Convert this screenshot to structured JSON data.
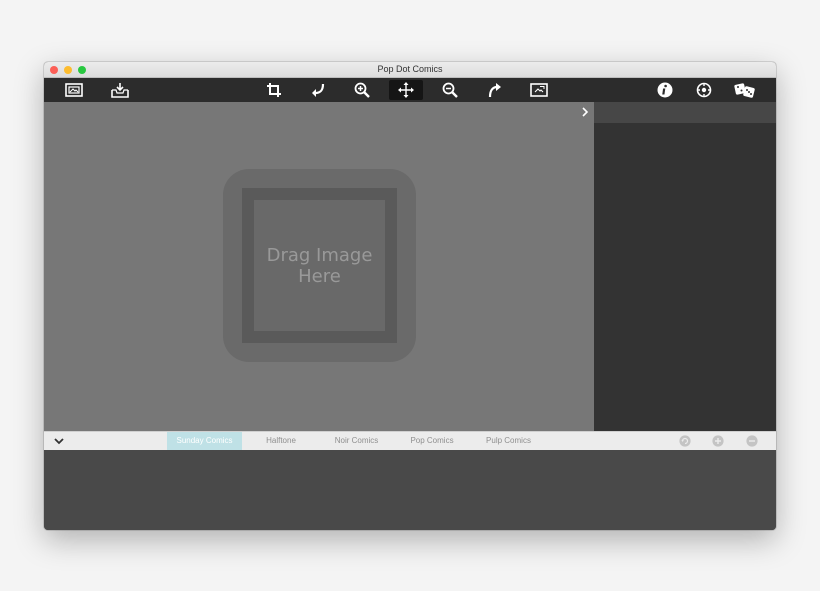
{
  "window": {
    "title": "Pop Dot Comics"
  },
  "toolbar": {
    "left_icons": [
      "open-image-icon",
      "save-image-icon"
    ],
    "center_icons": [
      "crop-icon",
      "undo-icon",
      "zoom-in-icon",
      "move-icon",
      "zoom-out-icon",
      "redo-icon",
      "fit-image-icon"
    ],
    "right_icons": [
      "info-icon",
      "settings-icon",
      "random-dice-icon"
    ],
    "active_tool": "move"
  },
  "canvas": {
    "drop_text": "Drag Image Here"
  },
  "filters": {
    "tabs": [
      {
        "label": "Sunday Comics",
        "selected": true
      },
      {
        "label": "Halftone",
        "selected": false
      },
      {
        "label": "Noir Comics",
        "selected": false
      },
      {
        "label": "Pop Comics",
        "selected": false
      },
      {
        "label": "Pulp Comics",
        "selected": false
      }
    ],
    "actions": [
      "refresh-icon",
      "add-icon",
      "remove-icon"
    ]
  },
  "colors": {
    "toolbar": "#2c2c2c",
    "canvas": "#777777",
    "side_panel": "#333333",
    "selected_tab": "#bfe1e6"
  }
}
